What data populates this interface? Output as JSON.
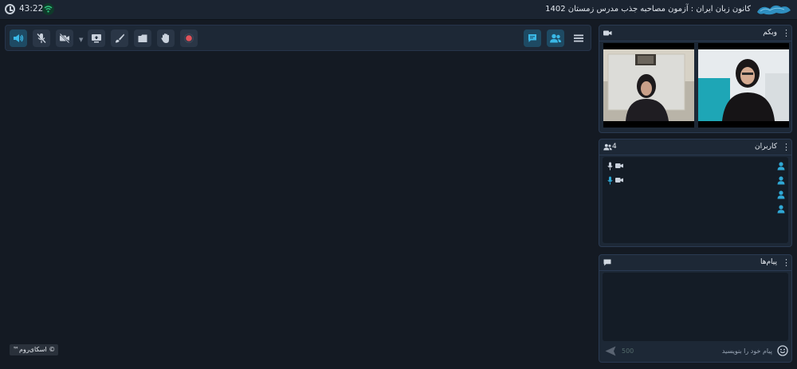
{
  "statusbar": {
    "time": "43:22",
    "session_title": "کانون زبان ایران : آزمون مصاحبه جذب مدرس زمستان 1402",
    "accent": "#2ec27e"
  },
  "toolbar": {
    "items": [
      {
        "name": "speaker-icon",
        "active": true
      },
      {
        "name": "mic-off-icon"
      },
      {
        "name": "camera-off-icon"
      },
      {
        "name": "screen-share-icon"
      },
      {
        "name": "brush-icon"
      },
      {
        "name": "files-icon"
      },
      {
        "name": "raise-hand-icon"
      },
      {
        "name": "record-icon"
      }
    ],
    "right_items": [
      {
        "name": "chat-icon"
      },
      {
        "name": "users-icon"
      },
      {
        "name": "menu-icon"
      }
    ]
  },
  "webcam_panel": {
    "title": "وبکم"
  },
  "users_panel": {
    "title": "کاربران",
    "count": "4",
    "users": [
      {
        "has_mic": true,
        "mic_active": false,
        "has_cam": true
      },
      {
        "has_mic": true,
        "mic_active": true,
        "has_cam": true
      },
      {
        "has_mic": false,
        "has_cam": false
      },
      {
        "has_mic": false,
        "has_cam": false
      }
    ]
  },
  "messages_panel": {
    "title": "پیام‌ها",
    "placeholder": "پیام خود را بنویسید",
    "char_limit": "500"
  },
  "branding": {
    "label": "© اسکای‌روم™"
  },
  "colors": {
    "accent_blue": "#2fa8d5",
    "bg": "#141a23",
    "panel": "#1d2836",
    "record": "#e0525a"
  }
}
